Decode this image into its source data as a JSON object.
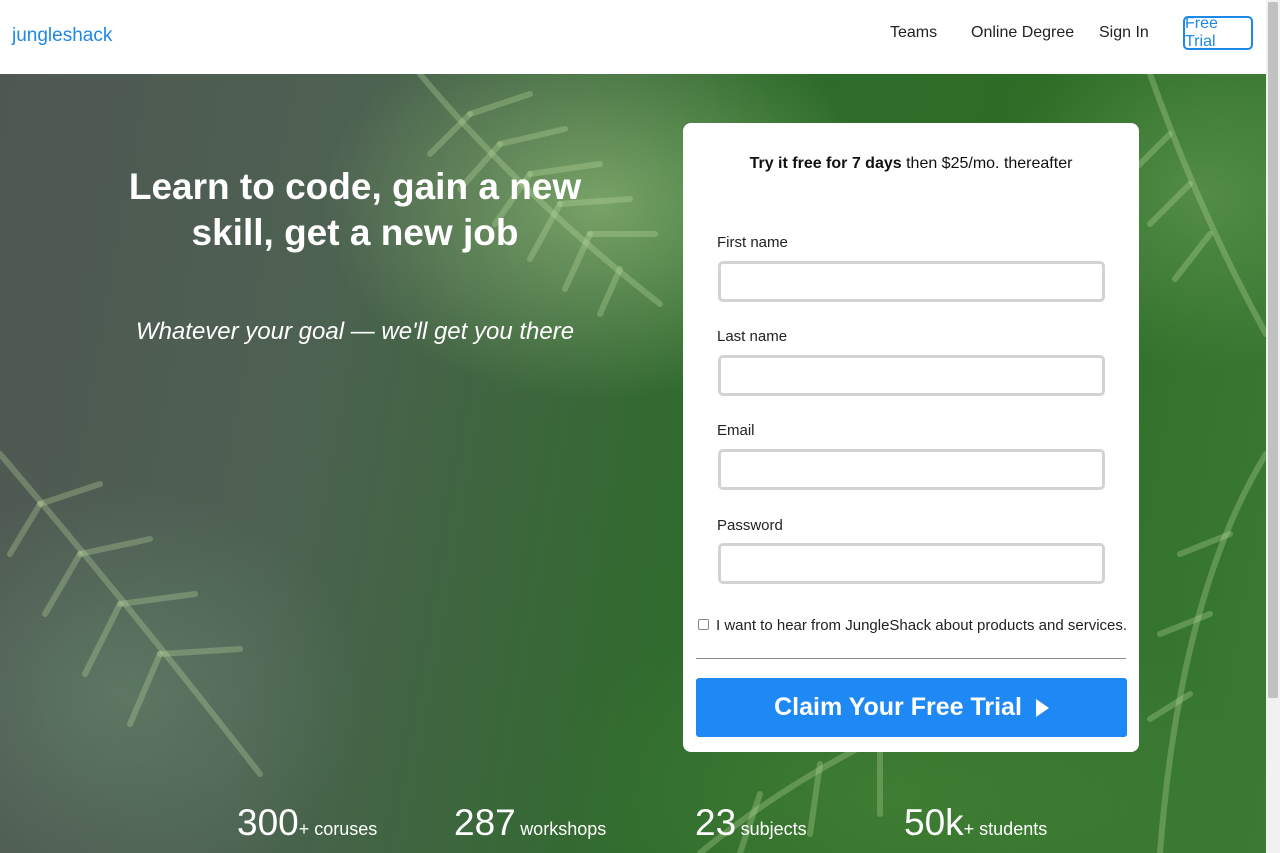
{
  "header": {
    "logo": "jungleshack",
    "nav": {
      "teams": "Teams",
      "online_degree": "Online Degree",
      "sign_in": "Sign In",
      "free_trial": "Free Trial"
    }
  },
  "hero": {
    "headline_line1": "Learn to code, gain a new",
    "headline_line2": "skill, get a new job",
    "subheadline": "Whatever your goal — we'll get you there"
  },
  "form": {
    "promo_bold": "Try it free for 7 days",
    "promo_rest": "then $25/mo. thereafter",
    "first_name_label": "First name",
    "first_name_value": "",
    "last_name_label": "Last name",
    "last_name_value": "",
    "email_label": "Email",
    "email_value": "",
    "password_label": "Password",
    "password_value": "",
    "optin_label": "I want to hear from JungleShack about products and services.",
    "optin_checked": false,
    "submit_label": "Claim Your Free Trial"
  },
  "stats": [
    {
      "number": "300",
      "label": "+ coruses"
    },
    {
      "number": "287",
      "label": "workshops"
    },
    {
      "number": "23",
      "label": "subjects"
    },
    {
      "number": "50k",
      "label": "+ students"
    }
  ],
  "colors": {
    "accent": "#1e88e5",
    "button": "#1e88f5",
    "hero_green": "#2f6b2c"
  },
  "icons": {
    "submit": "play-triangle-icon"
  }
}
